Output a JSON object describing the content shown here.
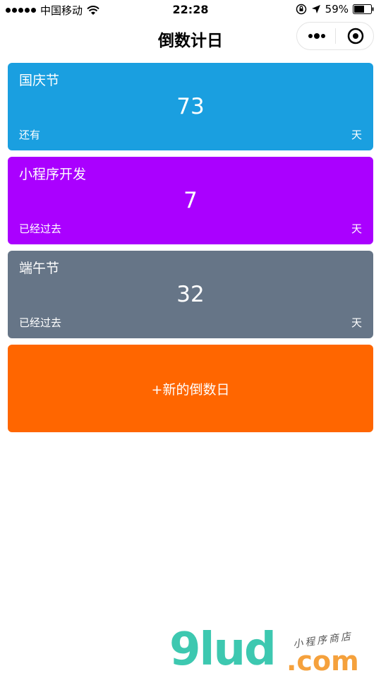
{
  "status_bar": {
    "carrier": "中国移动",
    "time": "22:28",
    "battery": "59%"
  },
  "nav": {
    "title": "倒数计日"
  },
  "cards": [
    {
      "title": "国庆节",
      "number": "73",
      "status": "还有",
      "unit": "天",
      "color": "#1a9fe0"
    },
    {
      "title": "小程序开发",
      "number": "7",
      "status": "已经过去",
      "unit": "天",
      "color": "#aa00ff"
    },
    {
      "title": "端午节",
      "number": "32",
      "status": "已经过去",
      "unit": "天",
      "color": "#667587"
    }
  ],
  "add_button": {
    "label": "+新的倒数日",
    "color": "#ff6600"
  },
  "watermark": {
    "logo": "9lud",
    "sub": "小程序商店",
    "domain": ".com"
  }
}
